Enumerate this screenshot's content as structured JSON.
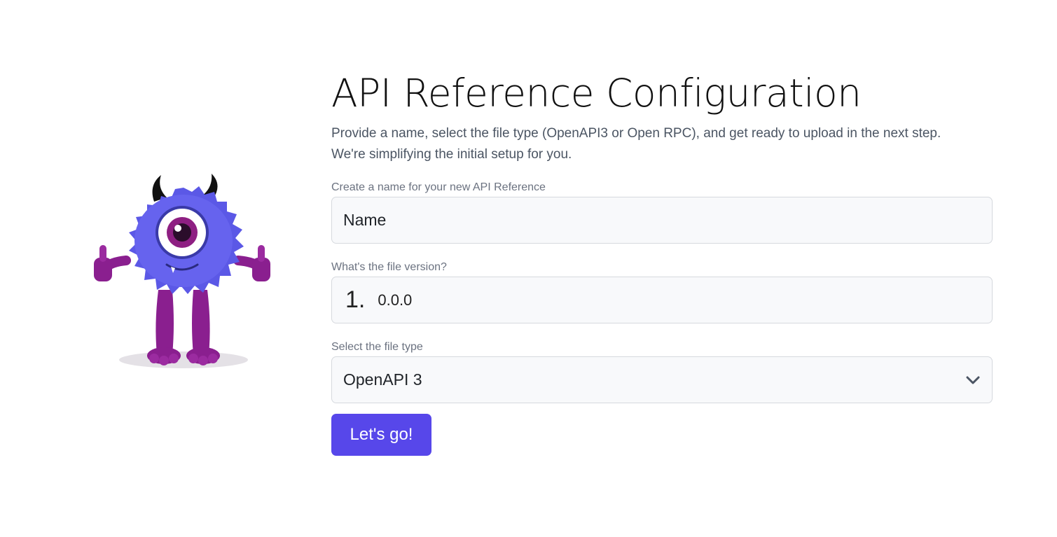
{
  "header": {
    "title": "API Reference Configuration",
    "subtitle_line1": "Provide a name, select the file type (OpenAPI3 or Open RPC), and get ready to upload in the next step.",
    "subtitle_line2": "We're simplifying the initial setup for you."
  },
  "form": {
    "name": {
      "label": "Create a name for your new API Reference",
      "placeholder": "Name",
      "value": ""
    },
    "version": {
      "label": "What's the file version?",
      "prefix": "1.",
      "value": "0.0.0"
    },
    "file_type": {
      "label": "Select the file type",
      "selected": "OpenAPI 3",
      "icon": "chevron-down-icon"
    },
    "submit_label": "Let's go!"
  },
  "mascot": {
    "icon": "monster-mascot-illustration",
    "colors": {
      "fur": "#5b58e6",
      "legs": "#8a1f8f",
      "eye_iris": "#8e1f82",
      "horns": "#111111"
    }
  },
  "colors": {
    "accent": "#5747ea",
    "field_background": "#f8f9fb",
    "field_border": "#d6d9de",
    "label_text": "#6b7280",
    "subtitle_text": "#4b5563"
  }
}
